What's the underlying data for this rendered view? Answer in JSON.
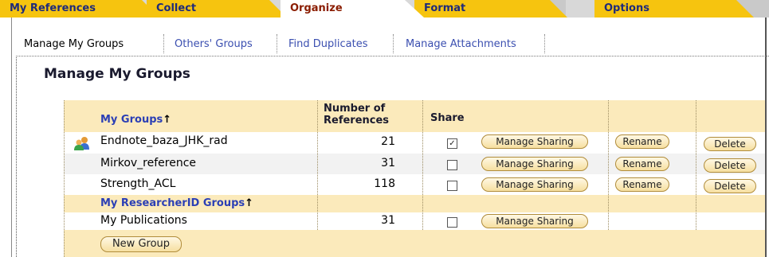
{
  "tabs": [
    {
      "label": "My References"
    },
    {
      "label": "Collect"
    },
    {
      "label": "Organize"
    },
    {
      "label": "Format"
    },
    {
      "label": "Options"
    }
  ],
  "subnav": [
    {
      "label": "Manage My Groups"
    },
    {
      "label": "Others' Groups"
    },
    {
      "label": "Find Duplicates"
    },
    {
      "label": "Manage Attachments"
    }
  ],
  "page_title": "Manage My Groups",
  "table": {
    "header": {
      "groups": "My Groups",
      "sort_arrow": "↑",
      "num_line1": "Number of",
      "num_line2": "References",
      "share": "Share"
    },
    "groups": [
      {
        "name": "Endnote_baza_JHK_rad",
        "count": "21",
        "shared": true,
        "check": "✓"
      },
      {
        "name": "Mirkov_reference",
        "count": "31",
        "shared": false,
        "check": ""
      },
      {
        "name": "Strength_ACL",
        "count": "118",
        "shared": false,
        "check": ""
      }
    ],
    "researcher_section": {
      "label": "My ResearcherID Groups",
      "sort_arrow": "↑"
    },
    "researcher_groups": [
      {
        "name": "My Publications",
        "count": "31",
        "shared": false,
        "check": ""
      }
    ],
    "buttons": {
      "manage_sharing": "Manage Sharing",
      "rename": "Rename",
      "delete": "Delete",
      "new_group": "New Group"
    }
  },
  "colors": {
    "tab_inactive": "#f6c40f",
    "tab_text": "#1f2b7a",
    "tab_active_text": "#8a1c00",
    "header_bg": "#fbeabb",
    "link_blue": "#2b3fb5"
  },
  "icons": {
    "group": "group-users-icon"
  }
}
